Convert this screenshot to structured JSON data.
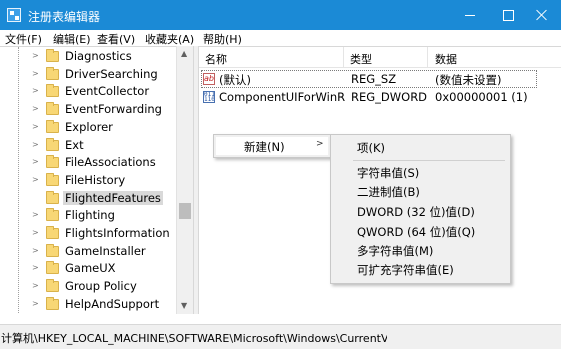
{
  "window": {
    "title": "注册表编辑器",
    "icon": "registry-icon"
  },
  "menubar": {
    "items": [
      "文件(F)",
      "编辑(E)",
      "查看(V)",
      "收藏夹(A)",
      "帮助(H)"
    ]
  },
  "tree": {
    "items": [
      {
        "label": "Diagnostics",
        "expandable": true
      },
      {
        "label": "DriverSearching",
        "expandable": true
      },
      {
        "label": "EventCollector",
        "expandable": true
      },
      {
        "label": "EventForwarding",
        "expandable": true
      },
      {
        "label": "Explorer",
        "expandable": true
      },
      {
        "label": "Ext",
        "expandable": true
      },
      {
        "label": "FileAssociations",
        "expandable": true
      },
      {
        "label": "FileHistory",
        "expandable": true
      },
      {
        "label": "FlightedFeatures",
        "expandable": false,
        "selected": true
      },
      {
        "label": "Flighting",
        "expandable": true
      },
      {
        "label": "FlightsInformation",
        "expandable": true
      },
      {
        "label": "GameInstaller",
        "expandable": true
      },
      {
        "label": "GameUX",
        "expandable": true
      },
      {
        "label": "Group Policy",
        "expandable": true
      },
      {
        "label": "HelpAndSupport",
        "expandable": true
      }
    ]
  },
  "values": {
    "columns": [
      "名称",
      "类型",
      "数据"
    ],
    "rows": [
      {
        "icon": "string-value-icon",
        "name": "(默认)",
        "type": "REG_SZ",
        "data": "(数值未设置)",
        "focused": true
      },
      {
        "icon": "binary-value-icon",
        "name": "ComponentUIForWinR...",
        "type": "REG_DWORD",
        "data": "0x00000001 (1)",
        "focused": false
      }
    ]
  },
  "context_menu": {
    "new_label": "新建(N)",
    "submenu": [
      "项(K)",
      "字符串值(S)",
      "二进制值(B)",
      "DWORD (32 位)值(D)",
      "QWORD (64 位)值(Q)",
      "多字符串值(M)",
      "可扩充字符串值(E)"
    ]
  },
  "statusbar": {
    "path": "计算机\\HKEY_LOCAL_MACHINE\\SOFTWARE\\Microsoft\\Windows\\CurrentVer"
  }
}
